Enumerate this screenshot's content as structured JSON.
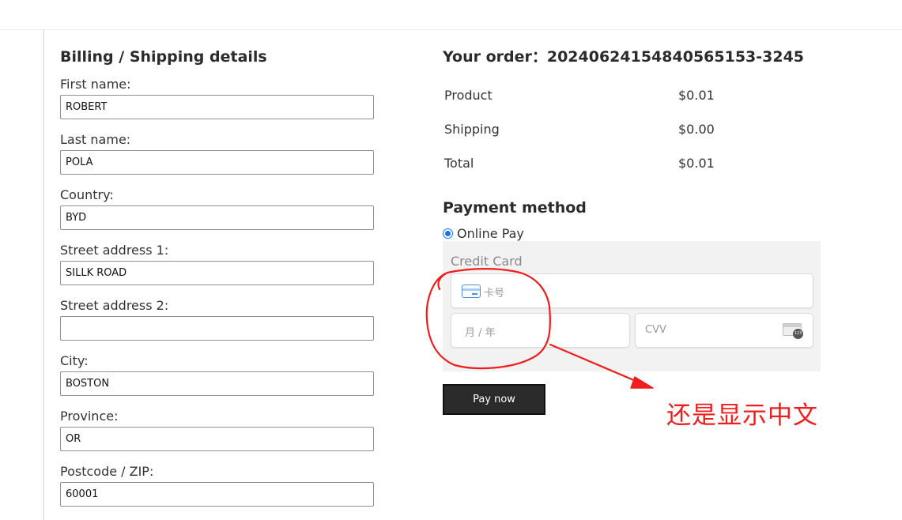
{
  "billing": {
    "title": "Billing / Shipping details",
    "fields": [
      {
        "label": "First name:",
        "value": "ROBERT"
      },
      {
        "label": "Last name:",
        "value": "POLA"
      },
      {
        "label": "Country:",
        "value": "BYD"
      },
      {
        "label": "Street address 1:",
        "value": "SILLK ROAD"
      },
      {
        "label": "Street address 2:",
        "value": ""
      },
      {
        "label": "City:",
        "value": "BOSTON"
      },
      {
        "label": "Province:",
        "value": "OR"
      },
      {
        "label": "Postcode / ZIP:",
        "value": "60001"
      }
    ]
  },
  "order": {
    "title": "Your order：20240624154840565153-3245",
    "rows": [
      {
        "label": "Product",
        "value": "$0.01"
      },
      {
        "label": "Shipping",
        "value": "$0.00"
      },
      {
        "label": "Total",
        "value": "$0.01"
      }
    ]
  },
  "payment": {
    "title": "Payment method",
    "option_label": "Online Pay",
    "option_selected": true,
    "card_title": "Credit Card",
    "card_number_placeholder": "卡号",
    "expiry_placeholder": "月 / 年",
    "cvv_placeholder": "CVV",
    "cvv_badge": "123",
    "pay_button": "Pay now"
  },
  "annotation": {
    "text": "还是显示中文",
    "color": "#f01d1d"
  },
  "colors": {
    "accent": "#1a73e8",
    "button_bg": "#2b2b2b",
    "card_panel_bg": "#f2f2f2"
  }
}
